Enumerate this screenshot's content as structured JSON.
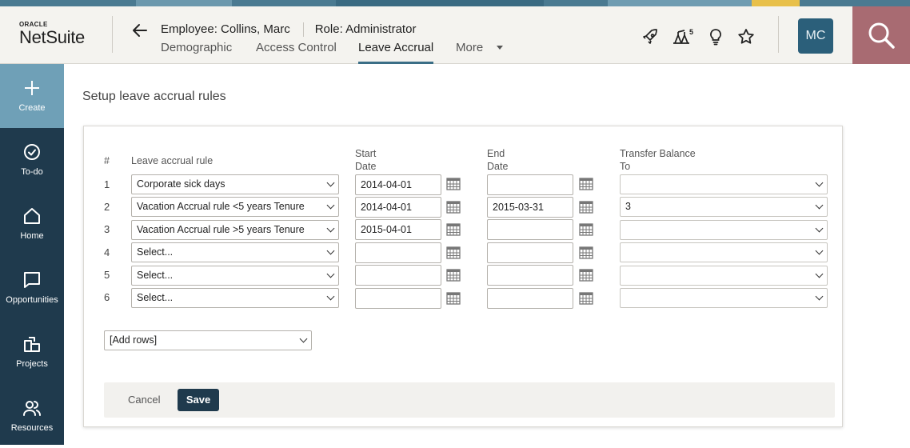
{
  "brand": {
    "oracle": "ORACLE",
    "product": "NetSuite"
  },
  "record": {
    "employee": "Employee: Collins, Marc",
    "role": "Role: Administrator"
  },
  "tabs": [
    {
      "label": "Demographic"
    },
    {
      "label": "Access Control"
    },
    {
      "label": "Leave Accrual",
      "active": true
    },
    {
      "label": "More"
    }
  ],
  "header_icons": {
    "notifications_count": "5"
  },
  "user": {
    "initials": "MC"
  },
  "sidebar": [
    {
      "label": "Create"
    },
    {
      "label": "To-do"
    },
    {
      "label": "Home"
    },
    {
      "label": "Opportunities"
    },
    {
      "label": "Projects"
    },
    {
      "label": "Resources"
    }
  ],
  "page": {
    "title": "Setup leave accrual rules"
  },
  "table": {
    "headers": {
      "num": "#",
      "rule": "Leave accrual rule",
      "start": [
        "Start",
        "Date"
      ],
      "end": [
        "End",
        "Date"
      ],
      "transfer": [
        "Transfer Balance",
        "To"
      ]
    },
    "rows": [
      {
        "num": "1",
        "rule": "Corporate sick days",
        "start": "2014-04-01",
        "end": "",
        "transfer": ""
      },
      {
        "num": "2",
        "rule": "Vacation Accrual rule <5 years Tenure",
        "start": "2014-04-01",
        "end": "2015-03-31",
        "transfer": "3"
      },
      {
        "num": "3",
        "rule": "Vacation Accrual rule >5 years Tenure",
        "start": "2015-04-01",
        "end": "",
        "transfer": ""
      },
      {
        "num": "4",
        "rule": "Select...",
        "start": "",
        "end": "",
        "transfer": ""
      },
      {
        "num": "5",
        "rule": "Select...",
        "start": "",
        "end": "",
        "transfer": ""
      },
      {
        "num": "6",
        "rule": "Select...",
        "start": "",
        "end": "",
        "transfer": ""
      }
    ]
  },
  "add_rows": {
    "label": "[Add rows]"
  },
  "actions": {
    "cancel": "Cancel",
    "save": "Save"
  },
  "colors": {
    "sidebar": "#1f3a4d",
    "sidebar_active": "#6fa0b7",
    "search_button": "#a86b72",
    "avatar": "#2b5f7a",
    "save_button": "#1f3a4d",
    "tab_underline": "#3b6e86"
  }
}
